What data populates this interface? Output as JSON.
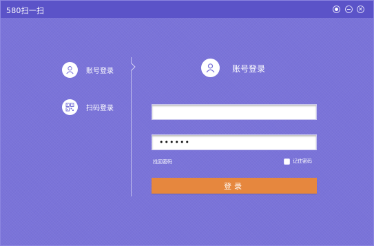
{
  "window": {
    "title": "580扫一扫"
  },
  "sidebar": {
    "items": [
      {
        "label": "账号登录",
        "icon": "user-icon"
      },
      {
        "label": "扫码登录",
        "icon": "qr-code-icon"
      }
    ]
  },
  "login": {
    "header_title": "账号登录",
    "username_value": "",
    "password_value": "••••••",
    "find_password": "找回密码",
    "remember_label": "记住密码",
    "remember_checked": false,
    "submit_label": "登录"
  },
  "colors": {
    "background": "#7a73d9",
    "titlebar": "#5b53c8",
    "button": "#e6873e",
    "icon": "#7a73d9"
  }
}
